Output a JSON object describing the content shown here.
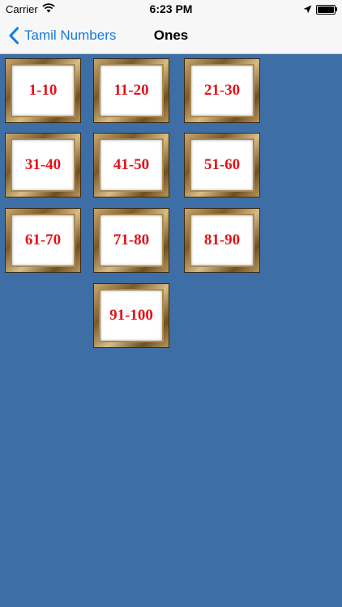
{
  "status_bar": {
    "carrier": "Carrier",
    "time": "6:23 PM"
  },
  "nav": {
    "back_label": "Tamil Numbers",
    "title": "Ones"
  },
  "tiles": [
    {
      "label": "1-10"
    },
    {
      "label": "11-20"
    },
    {
      "label": "21-30"
    },
    {
      "label": "31-40"
    },
    {
      "label": "41-50"
    },
    {
      "label": "51-60"
    },
    {
      "label": "61-70"
    },
    {
      "label": "71-80"
    },
    {
      "label": "81-90"
    },
    {
      "label": "91-100"
    }
  ],
  "colors": {
    "background": "#3d6ea5",
    "accent": "#1479e0",
    "tile_text": "#e0141b"
  }
}
